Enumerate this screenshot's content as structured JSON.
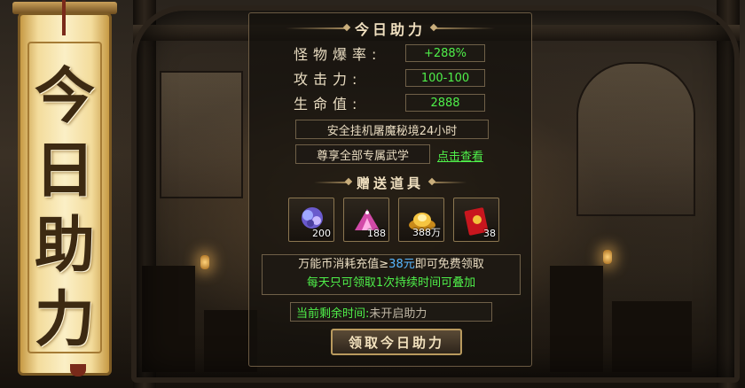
{
  "banner": {
    "chars": [
      "今",
      "日",
      "助",
      "力"
    ]
  },
  "panel": {
    "title": "今日助力",
    "stats": [
      {
        "label": "怪物爆率:",
        "value": "+288%"
      },
      {
        "label": "攻击力:",
        "value": "100-100"
      },
      {
        "label": "生命值:",
        "value": "2888"
      }
    ],
    "safe_text": "安全挂机屠魔秘境24小时",
    "exclusive_text": "尊享全部专属武学",
    "view_link": "点击查看",
    "gift_title": "赠送道具",
    "items": [
      {
        "icon": "crystal-ore-icon",
        "count": "200"
      },
      {
        "icon": "pink-gem-pile-icon",
        "count": "188"
      },
      {
        "icon": "gold-ingot-icon",
        "count": "388万"
      },
      {
        "icon": "red-envelope-icon",
        "count": "38"
      }
    ],
    "info": {
      "line1_prefix": "万能币消耗充值≥",
      "line1_amount": "38元",
      "line1_suffix": "即可免费领取",
      "line2": "每天只可领取1次持续时间可叠加"
    },
    "timer": {
      "label": "当前剩余时间:",
      "value": "未开启助力"
    },
    "claim_button": "领取今日助力"
  }
}
